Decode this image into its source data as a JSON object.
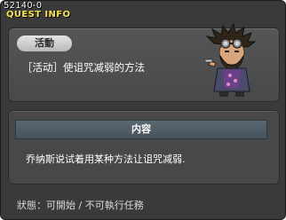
{
  "window": {
    "quest_id": "52140-0",
    "title": "QUEST INFO"
  },
  "quest": {
    "category": "活動",
    "name": "［活动］使诅咒减弱的方法"
  },
  "content": {
    "header": "内容",
    "text": "乔纳斯说试着用某种方法让诅咒减弱."
  },
  "status": {
    "text": "狀態：可開始 / 不可執行任務"
  },
  "colors": {
    "title": "#f6e24a",
    "window_bg": "#3a3a3b",
    "content_bar": "#4f5d67"
  }
}
